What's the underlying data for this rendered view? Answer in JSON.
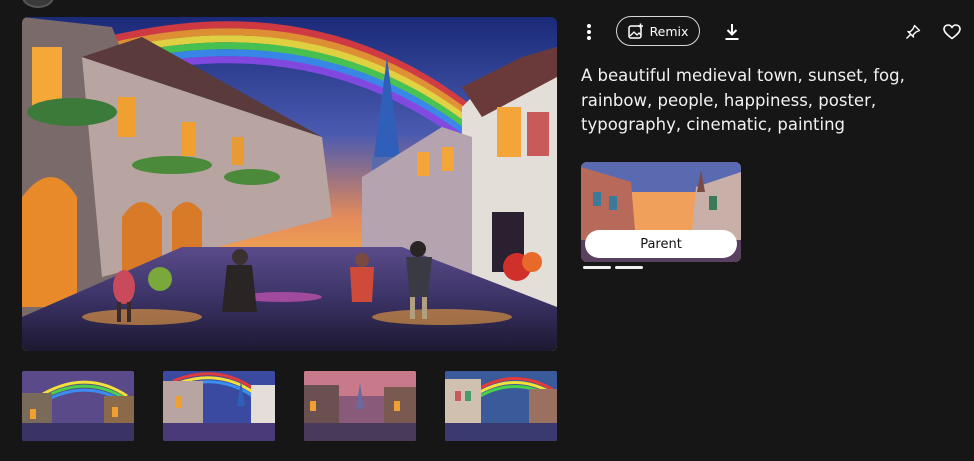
{
  "toolbar": {
    "remix_label": "Remix",
    "more_icon": "more-vertical-icon",
    "remix_icon": "image-plus-icon",
    "download_icon": "download-icon",
    "pin_icon": "pin-icon",
    "like_icon": "heart-icon"
  },
  "prompt": {
    "text": "A beautiful medieval town, sunset, fog, rainbow, people, happiness, poster, typography, cinematic, painting"
  },
  "parent": {
    "label": "Parent"
  },
  "variations": {
    "count": 4,
    "selected_index": 1
  },
  "colors": {
    "background": "#161616",
    "accent_text": "#ffffff",
    "button_border": "#d8d8d8"
  }
}
